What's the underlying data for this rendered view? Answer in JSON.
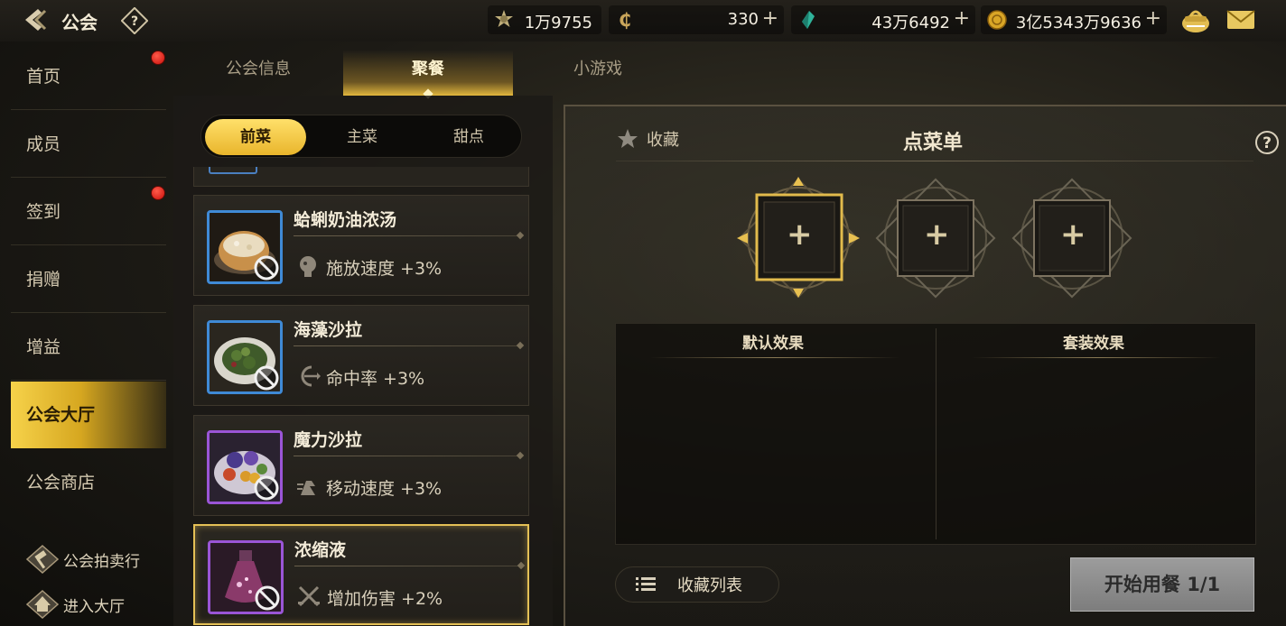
{
  "header": {
    "title": "公会",
    "resources": [
      {
        "icon": "honor-medal-icon",
        "value": "1万9755",
        "has_plus": false
      },
      {
        "icon": "coin-c-icon",
        "value": "330",
        "has_plus": true
      },
      {
        "icon": "green-gem-icon",
        "value": "43万6492",
        "has_plus": true
      },
      {
        "icon": "gold-coin-icon",
        "value": "3亿5343万9636",
        "has_plus": true
      }
    ]
  },
  "sidebar": {
    "items": [
      {
        "label": "首页",
        "badge": true
      },
      {
        "label": "成员",
        "badge": false
      },
      {
        "label": "签到",
        "badge": true
      },
      {
        "label": "捐赠",
        "badge": false
      },
      {
        "label": "增益",
        "badge": false
      },
      {
        "label": "公会大厅",
        "badge": false,
        "active": true
      },
      {
        "label": "公会商店",
        "badge": false
      }
    ],
    "links": [
      {
        "label": "公会拍卖行",
        "icon": "auction-hammer-icon"
      },
      {
        "label": "进入大厅",
        "icon": "hall-icon"
      }
    ]
  },
  "tabs": [
    {
      "label": "公会信息",
      "active": false
    },
    {
      "label": "聚餐",
      "active": true
    },
    {
      "label": "小游戏",
      "active": false
    }
  ],
  "subtabs": [
    {
      "label": "前菜",
      "active": true
    },
    {
      "label": "主菜",
      "active": false
    },
    {
      "label": "甜点",
      "active": false
    }
  ],
  "dishes": [
    {
      "name": "蛤蜊奶油浓汤",
      "effect": "施放速度 +3%",
      "rarity": "blue",
      "effect_icon": "cast-speed-icon",
      "image": "clam-chowder"
    },
    {
      "name": "海藻沙拉",
      "effect": "命中率 +3%",
      "rarity": "blue",
      "effect_icon": "accuracy-icon",
      "image": "seaweed-salad"
    },
    {
      "name": "魔力沙拉",
      "effect": "移动速度 +3%",
      "rarity": "purple",
      "effect_icon": "move-speed-icon",
      "image": "magic-salad"
    },
    {
      "name": "浓缩液",
      "effect": "增加伤害 +2%",
      "rarity": "purple",
      "effect_icon": "damage-icon",
      "image": "concentrate-flask",
      "selected": true
    }
  ],
  "menu": {
    "favorite_label": "收藏",
    "title": "点菜单",
    "slots": [
      "+",
      "+",
      "+"
    ],
    "default_effect_label": "默认效果",
    "set_effect_label": "套装效果",
    "fav_list_label": "收藏列表",
    "start_label": "开始用餐 1/1"
  },
  "colors": {
    "accent_gold": "#e9b52c",
    "rarity_blue": "#3f8ad6",
    "rarity_purple": "#9a55d6",
    "badge_red": "#c80f0a"
  }
}
